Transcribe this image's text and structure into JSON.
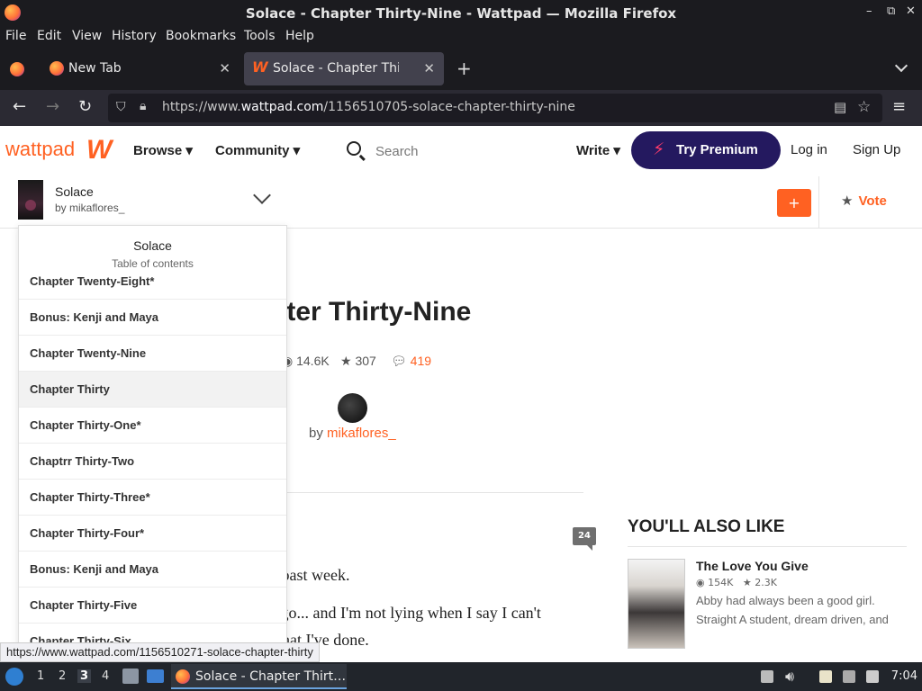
{
  "window": {
    "title": "Solace - Chapter Thirty-Nine - Wattpad — Mozilla Firefox",
    "controls": [
      "–",
      "⧉",
      "✕"
    ]
  },
  "menubar": [
    "File",
    "Edit",
    "View",
    "History",
    "Bookmarks",
    "Tools",
    "Help"
  ],
  "tabs": [
    {
      "label": "New Tab",
      "close": "✕"
    },
    {
      "label": "Solace - Chapter Thirty-N",
      "close": "✕"
    }
  ],
  "new_tab_symbol": "+",
  "urlbar": {
    "url_prefix": "https://www.",
    "url_domain": "wattpad.com",
    "url_path": "/1156510705-solace-chapter-thirty-nine"
  },
  "wattpad": {
    "logo_text": "wattpad",
    "logo_w": "W",
    "nav_browse": "Browse ▾",
    "nav_community": "Community ▾",
    "search_placeholder": "Search",
    "write": "Write ▾",
    "try_premium": "Try Premium",
    "premium_icon": "⚡",
    "login": "Log in",
    "signup": "Sign Up",
    "colors": {
      "brand": "#ff6122",
      "premium": "#24195f"
    }
  },
  "story": {
    "title": "Solace",
    "author": "by mikaflores_",
    "add_label": "+",
    "vote_label": "Vote",
    "vote_icon": "★"
  },
  "toc": {
    "title": "Solace",
    "subtitle": "Table of contents",
    "items": [
      "Chapter Twenty-Eight*",
      "Bonus: Kenji and Maya",
      "Chapter Twenty-Nine",
      "Chapter Thirty",
      "Chapter Thirty-One*",
      "Chaptrr Thirty-Two",
      "Chapter Thirty-Three*",
      "Chapter Thirty-Four*",
      "Bonus: Kenji and Maya",
      "Chapter Thirty-Five",
      "Chapter Thirty-Six"
    ]
  },
  "chapter": {
    "heading_visible": "pter Thirty-Nine",
    "reads": "14.6K",
    "votes": "307",
    "comments": "419",
    "by_label": "by",
    "author": "mikaflores_",
    "comment_count": "24",
    "text_lines": [
      "e past week.",
      "s go... and I'm not lying when I say I can't",
      "what I've done."
    ]
  },
  "recommendations": {
    "heading": "YOU'LL ALSO LIKE",
    "items": [
      {
        "title": "The Love You Give",
        "reads": "154K",
        "votes": "2.3K",
        "desc_line1": "Abby had always been a good girl.",
        "desc_line2": "Straight A student, dream driven, and"
      }
    ]
  },
  "status_link": "https://www.wattpad.com/1156510271-solace-chapter-thirty",
  "taskbar": {
    "workspaces": [
      "1",
      "2",
      "3",
      "4"
    ],
    "current_workspace": "3",
    "window_item": "Solace - Chapter Thirt…",
    "clock": "7:04"
  }
}
